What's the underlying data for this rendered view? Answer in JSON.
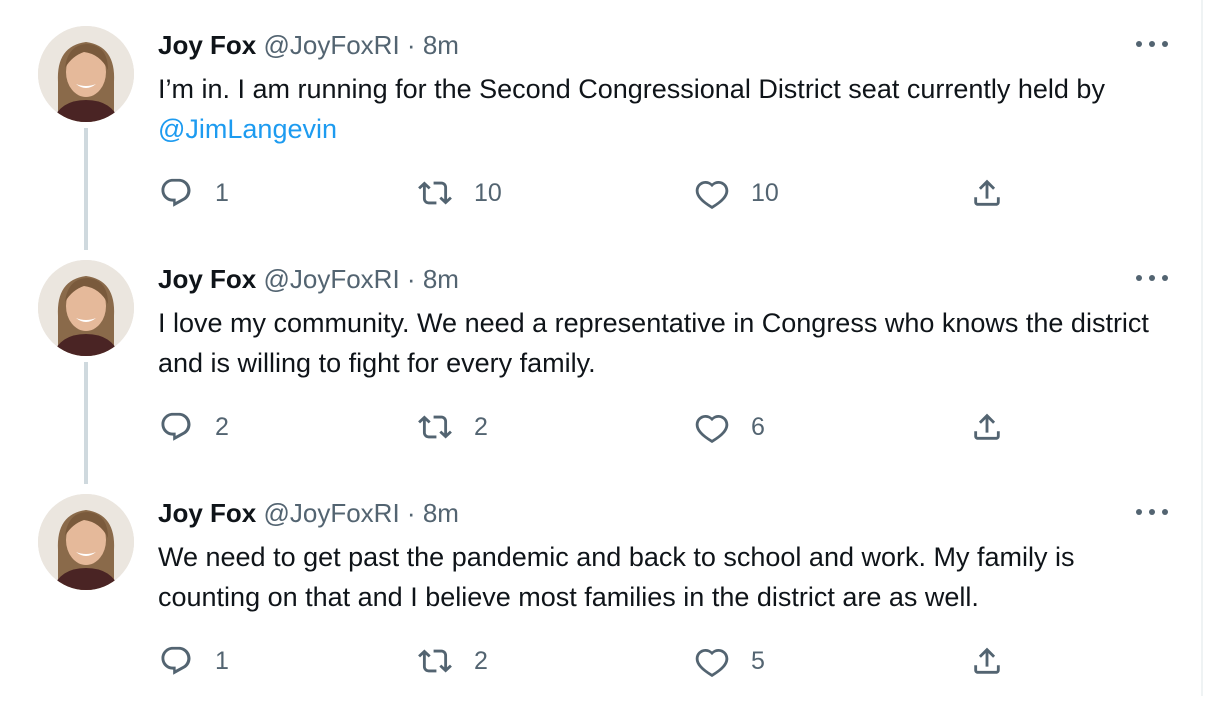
{
  "tweets": [
    {
      "author": "Joy Fox",
      "handle": "@JoyFoxRI",
      "separator": "·",
      "time": "8m",
      "text_before_mention": "I’m in. I am running for the Second Congressional District seat currently held by ",
      "mention": "@JimLangevin",
      "replies": "1",
      "retweets": "10",
      "likes": "10"
    },
    {
      "author": "Joy Fox",
      "handle": "@JoyFoxRI",
      "separator": "·",
      "time": "8m",
      "text": "I love my community. We need a representative in Congress who knows the district and is willing to fight for every family.",
      "replies": "2",
      "retweets": "2",
      "likes": "6"
    },
    {
      "author": "Joy Fox",
      "handle": "@JoyFoxRI",
      "separator": "·",
      "time": "8m",
      "text": "We need to get past the pandemic and back to school and work. My family is counting on that and I believe most families in the district are as well.",
      "replies": "1",
      "retweets": "2",
      "likes": "5"
    }
  ],
  "icons": {
    "avatar": "avatar",
    "more": "more-icon",
    "reply": "reply-icon",
    "retweet": "retweet-icon",
    "like": "heart-icon",
    "share": "share-icon"
  },
  "colors": {
    "text": "#0f1419",
    "secondary": "#536471",
    "link": "#1d9bf0",
    "thread_line": "#cfd9de"
  }
}
